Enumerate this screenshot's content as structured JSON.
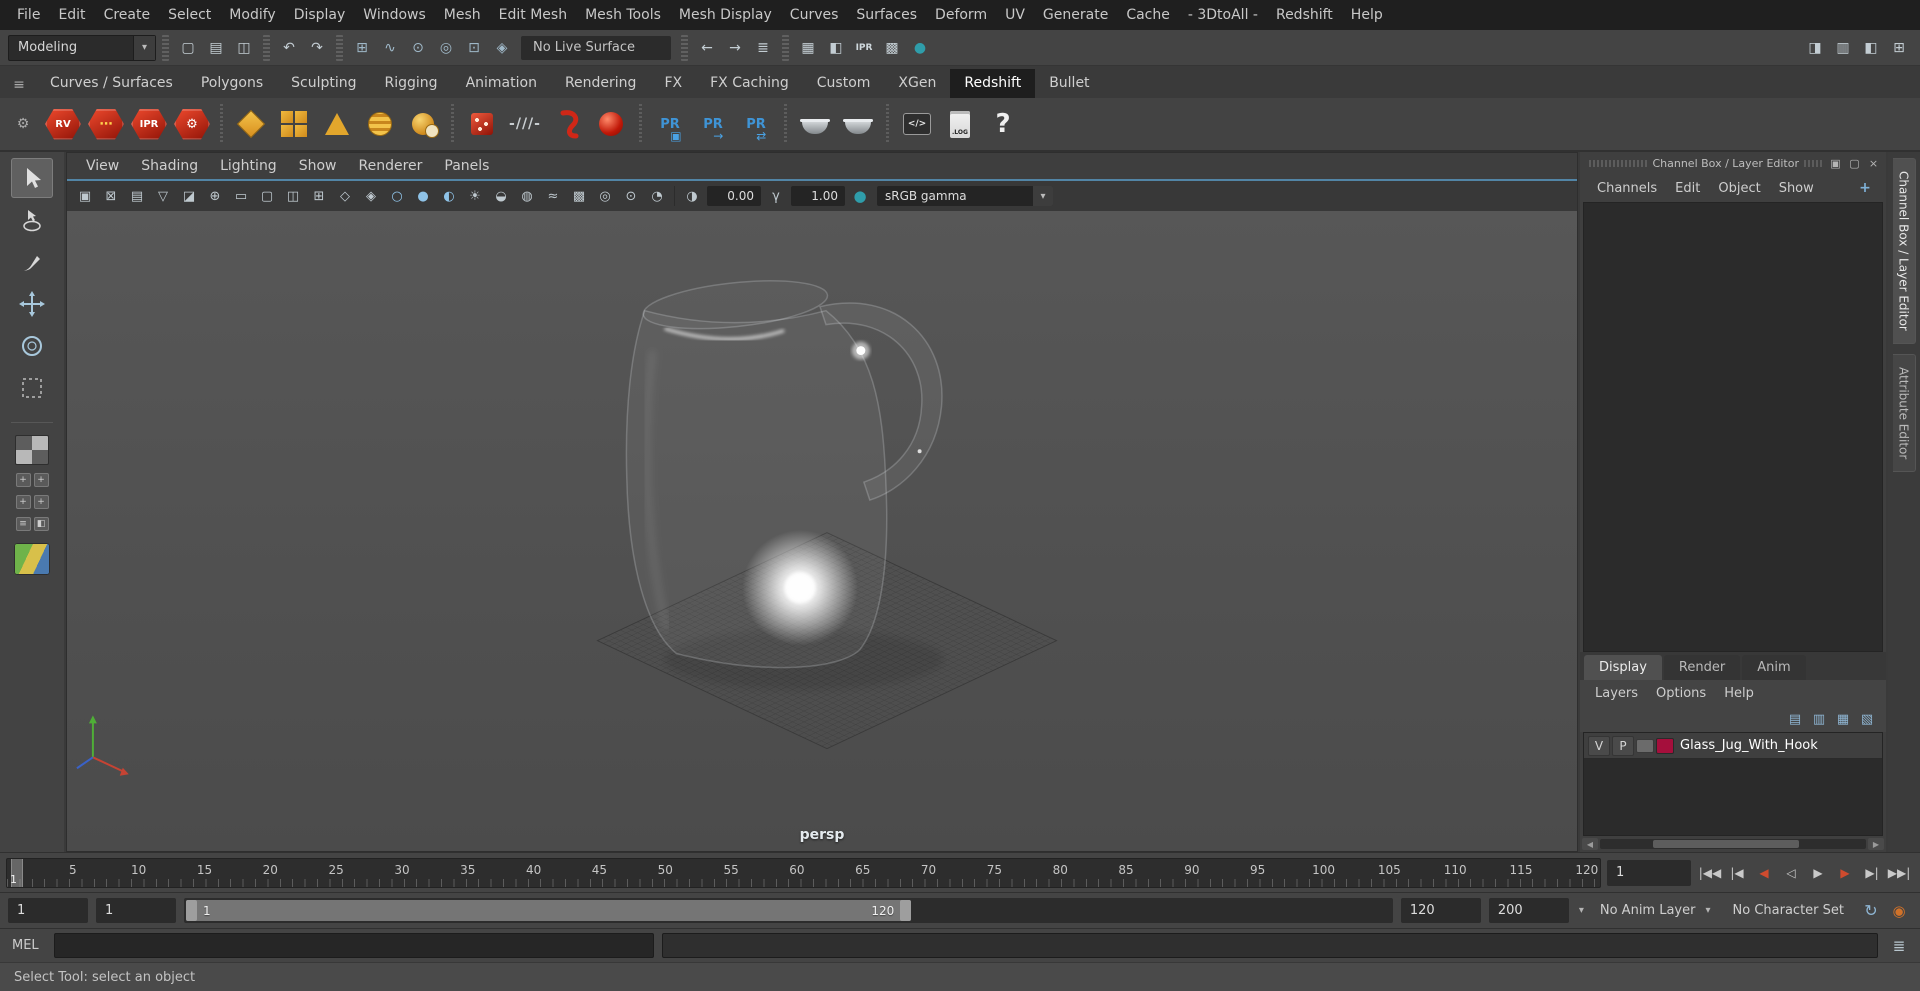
{
  "menubar": {
    "items": [
      "File",
      "Edit",
      "Create",
      "Select",
      "Modify",
      "Display",
      "Windows",
      "Mesh",
      "Edit Mesh",
      "Mesh Tools",
      "Mesh Display",
      "Curves",
      "Surfaces",
      "Deform",
      "UV",
      "Generate",
      "Cache",
      "- 3DtoAll -",
      "Redshift",
      "Help"
    ]
  },
  "ui_glyphs": {
    "dropdown_arrow": "▾",
    "hamburger": "≡",
    "gear": "⚙",
    "ellipsis": "⋯",
    "left_arrow": "◀",
    "right_arrow": "▶",
    "pr_cube": "▣",
    "pr_arrow": "→",
    "pr_sync": "⇄",
    "command_icon": "≣"
  },
  "status_line": {
    "mode_selector": "Modeling",
    "live_surface_field": "No Live Surface",
    "file_icons": [
      {
        "name": "new-scene-icon",
        "glyph": "▢"
      },
      {
        "name": "open-scene-icon",
        "glyph": "▤"
      },
      {
        "name": "save-scene-icon",
        "glyph": "◫"
      }
    ],
    "undo_icons": [
      {
        "name": "undo-icon",
        "glyph": "↶"
      },
      {
        "name": "redo-icon",
        "glyph": "↷"
      }
    ],
    "snap_icons": [
      {
        "name": "snap-to-grid-icon",
        "glyph": "⊞",
        "style": "color:#9fb8c8"
      },
      {
        "name": "snap-to-curve-icon",
        "glyph": "∿",
        "style": "color:#9fb8c8"
      },
      {
        "name": "snap-to-point-icon",
        "glyph": "⊙",
        "style": "color:#9fb8c8"
      },
      {
        "name": "snap-to-projected-center-icon",
        "glyph": "◎",
        "style": "color:#9fb8c8"
      },
      {
        "name": "snap-to-view-plane-icon",
        "glyph": "⊡",
        "style": "color:#9fb8c8"
      },
      {
        "name": "make-object-live-icon",
        "glyph": "◈",
        "style": "color:#9fb8c8"
      }
    ],
    "history_icons": [
      {
        "name": "input-connections-icon",
        "glyph": "←"
      },
      {
        "name": "output-connections-icon",
        "glyph": "→"
      },
      {
        "name": "construction-history-icon",
        "glyph": "≣"
      }
    ],
    "render_icons": [
      {
        "name": "open-render-view-icon",
        "glyph": "▦"
      },
      {
        "name": "render-current-frame-icon",
        "glyph": "◧"
      },
      {
        "name": "ipr-render-icon",
        "glyph": "IPR",
        "txt": true
      },
      {
        "name": "render-settings-icon",
        "glyph": "▩"
      },
      {
        "name": "hypershade-icon",
        "glyph": "●",
        "style": "color:#2f9daa"
      }
    ],
    "right_icons": [
      {
        "name": "sidebar-channelbox-toggle-icon",
        "glyph": "◨"
      },
      {
        "name": "sidebar-attribute-editor-toggle-icon",
        "glyph": "▥"
      },
      {
        "name": "sidebar-tool-settings-toggle-icon",
        "glyph": "◧"
      },
      {
        "name": "workspace-layout-icon",
        "glyph": "⊞"
      }
    ]
  },
  "shelf": {
    "tabs": [
      {
        "label": "Curves / Surfaces"
      },
      {
        "label": "Polygons"
      },
      {
        "label": "Sculpting"
      },
      {
        "label": "Rigging"
      },
      {
        "label": "Animation"
      },
      {
        "label": "Rendering"
      },
      {
        "label": "FX"
      },
      {
        "label": "FX Caching"
      },
      {
        "label": "Custom"
      },
      {
        "label": "XGen"
      },
      {
        "label": "Redshift",
        "active": true
      },
      {
        "label": "Bullet"
      }
    ],
    "icon_text": {
      "rv": "RV",
      "ipr": "IPR",
      "pr": "PR",
      "log": ".LOG",
      "help": "?",
      "slashes": "-///-",
      "code": "</>"
    }
  },
  "toolbox": {
    "tools": [
      "select-tool",
      "lasso-select-tool",
      "paint-selection-tool",
      "move-tool",
      "rotate-tool",
      "last-tool-used"
    ]
  },
  "viewport": {
    "menus": [
      "View",
      "Shading",
      "Lighting",
      "Show",
      "Renderer",
      "Panels"
    ],
    "toolbar_icons": [
      {
        "name": "select-camera-icon",
        "glyph": "▣"
      },
      {
        "name": "lock-camera-icon",
        "glyph": "⊠"
      },
      {
        "name": "camera-attributes-icon",
        "glyph": "▤"
      },
      {
        "name": "bookmarks-icon",
        "glyph": "▽"
      },
      {
        "name": "image-plane-icon",
        "glyph": "◪"
      },
      {
        "name": "two-d-pan-zoom-icon",
        "glyph": "⊕"
      },
      {
        "name": "film-gate-icon",
        "glyph": "▭"
      },
      {
        "name": "resolution-gate-icon",
        "glyph": "▢"
      },
      {
        "name": "gate-mask-icon",
        "glyph": "◫"
      },
      {
        "name": "field-chart-icon",
        "glyph": "⊞"
      },
      {
        "name": "safe-action-icon",
        "glyph": "◇"
      },
      {
        "name": "safe-title-icon",
        "glyph": "◈"
      },
      {
        "name": "wireframe-icon",
        "glyph": "○",
        "style": "color:#8fc3e8"
      },
      {
        "name": "smooth-shade-icon",
        "glyph": "●",
        "style": "color:#8fc3e8"
      },
      {
        "name": "textured-icon",
        "glyph": "◐",
        "style": "color:#8fc3e8"
      },
      {
        "name": "lighting-icon",
        "glyph": "☀"
      },
      {
        "name": "shadows-icon",
        "glyph": "◒"
      },
      {
        "name": "screen-space-ao-icon",
        "glyph": "◍"
      },
      {
        "name": "motion-blur-icon",
        "glyph": "≈"
      },
      {
        "name": "multisample-aa-icon",
        "glyph": "▩"
      },
      {
        "name": "depth-of-field-icon",
        "glyph": "◎"
      },
      {
        "name": "isolate-select-icon",
        "glyph": "⊙"
      },
      {
        "name": "xray-icon",
        "glyph": "◔"
      }
    ],
    "exposure_icon_glyph": "◑",
    "exposure": "0.00",
    "gamma_icon_glyph": "γ",
    "gamma": "1.00",
    "view_transform": "sRGB gamma",
    "camera_label": "persp"
  },
  "channel_box": {
    "title": "Channel Box / Layer Editor",
    "header_icons": [
      {
        "name": "dock-panel-icon",
        "glyph": "▣"
      },
      {
        "name": "float-panel-icon",
        "glyph": "▢"
      },
      {
        "name": "close-panel-icon",
        "glyph": "×"
      }
    ],
    "menus": [
      "Channels",
      "Edit",
      "Object",
      "Show"
    ],
    "menu_icons": [
      {
        "name": "show-manipulators-icon",
        "glyph": "+",
        "style": "color:#7fb2d9;font-weight:bold"
      }
    ],
    "layer_editor": {
      "tabs": [
        {
          "label": "Display",
          "active": true
        },
        {
          "label": "Render"
        },
        {
          "label": "Anim"
        }
      ],
      "menus": [
        "Layers",
        "Options",
        "Help"
      ],
      "icons": [
        {
          "name": "new-empty-layer-icon",
          "glyph": "▤",
          "style": "color:#8fb6d4"
        },
        {
          "name": "new-layer-from-selected-icon",
          "glyph": "▥",
          "style": "color:#8fb6d4"
        },
        {
          "name": "new-render-layer-icon",
          "glyph": "▦",
          "style": "color:#8fb6d4"
        },
        {
          "name": "layer-options-icon",
          "glyph": "▧",
          "style": "color:#8fb6d4"
        }
      ],
      "layers": [
        {
          "visibility": "V",
          "playback": "P",
          "name": "Glass_Jug_With_Hook",
          "color": "#a50f3c"
        }
      ]
    }
  },
  "right_sidebar": {
    "tabs": [
      "Channel Box / Layer Editor",
      "Attribute Editor"
    ]
  },
  "time_slider": {
    "tick_labels": [
      "5",
      "10",
      "15",
      "20",
      "25",
      "30",
      "35",
      "40",
      "45",
      "50",
      "55",
      "60",
      "65",
      "70",
      "75",
      "80",
      "85",
      "90",
      "95",
      "100",
      "105",
      "110",
      "115",
      "120"
    ],
    "current_frame_marker_label": "1",
    "current_frame_field": "1",
    "playback_buttons": [
      {
        "name": "go-to-start-button",
        "glyph": "|◀◀"
      },
      {
        "name": "step-back-frame-button",
        "glyph": "|◀"
      },
      {
        "name": "step-back-key-button",
        "glyph": "◀",
        "accent": true
      },
      {
        "name": "play-backwards-button",
        "glyph": "◁"
      },
      {
        "name": "play-forwards-button",
        "glyph": "▶"
      },
      {
        "name": "step-forward-key-button",
        "glyph": "▶",
        "accent": true
      },
      {
        "name": "step-forward-frame-button",
        "glyph": "▶|"
      },
      {
        "name": "go-to-end-button",
        "glyph": "▶▶|"
      }
    ]
  },
  "range_slider": {
    "animation_start": "1",
    "playback_start": "1",
    "range_bar_start": "1",
    "range_bar_end": "120",
    "playback_end": "120",
    "animation_end": "200",
    "anim_layer": "No Anim Layer",
    "character_set": "No Character Set",
    "icons": [
      {
        "name": "auto-keyframe-icon",
        "glyph": "↻",
        "style": "color:#8fb6d4;font-size:16px"
      },
      {
        "name": "animation-preferences-icon",
        "glyph": "◉",
        "style": "color:#d0722a;font-size:15px"
      }
    ]
  },
  "command_line": {
    "label": "MEL"
  },
  "help_line": {
    "text": "Select Tool: select an object"
  },
  "colors": {
    "active_panel_highlight": "#5285a6",
    "shelf_icon_red": "#cc2a1c",
    "shelf_icon_yellow": "#e2a62c",
    "pr_label_blue": "#3f94d6",
    "layer_color_swatch": "#a50f3c",
    "hypershade_teal": "#2f9daa",
    "playback_key_accent": "#cf4b2e"
  }
}
